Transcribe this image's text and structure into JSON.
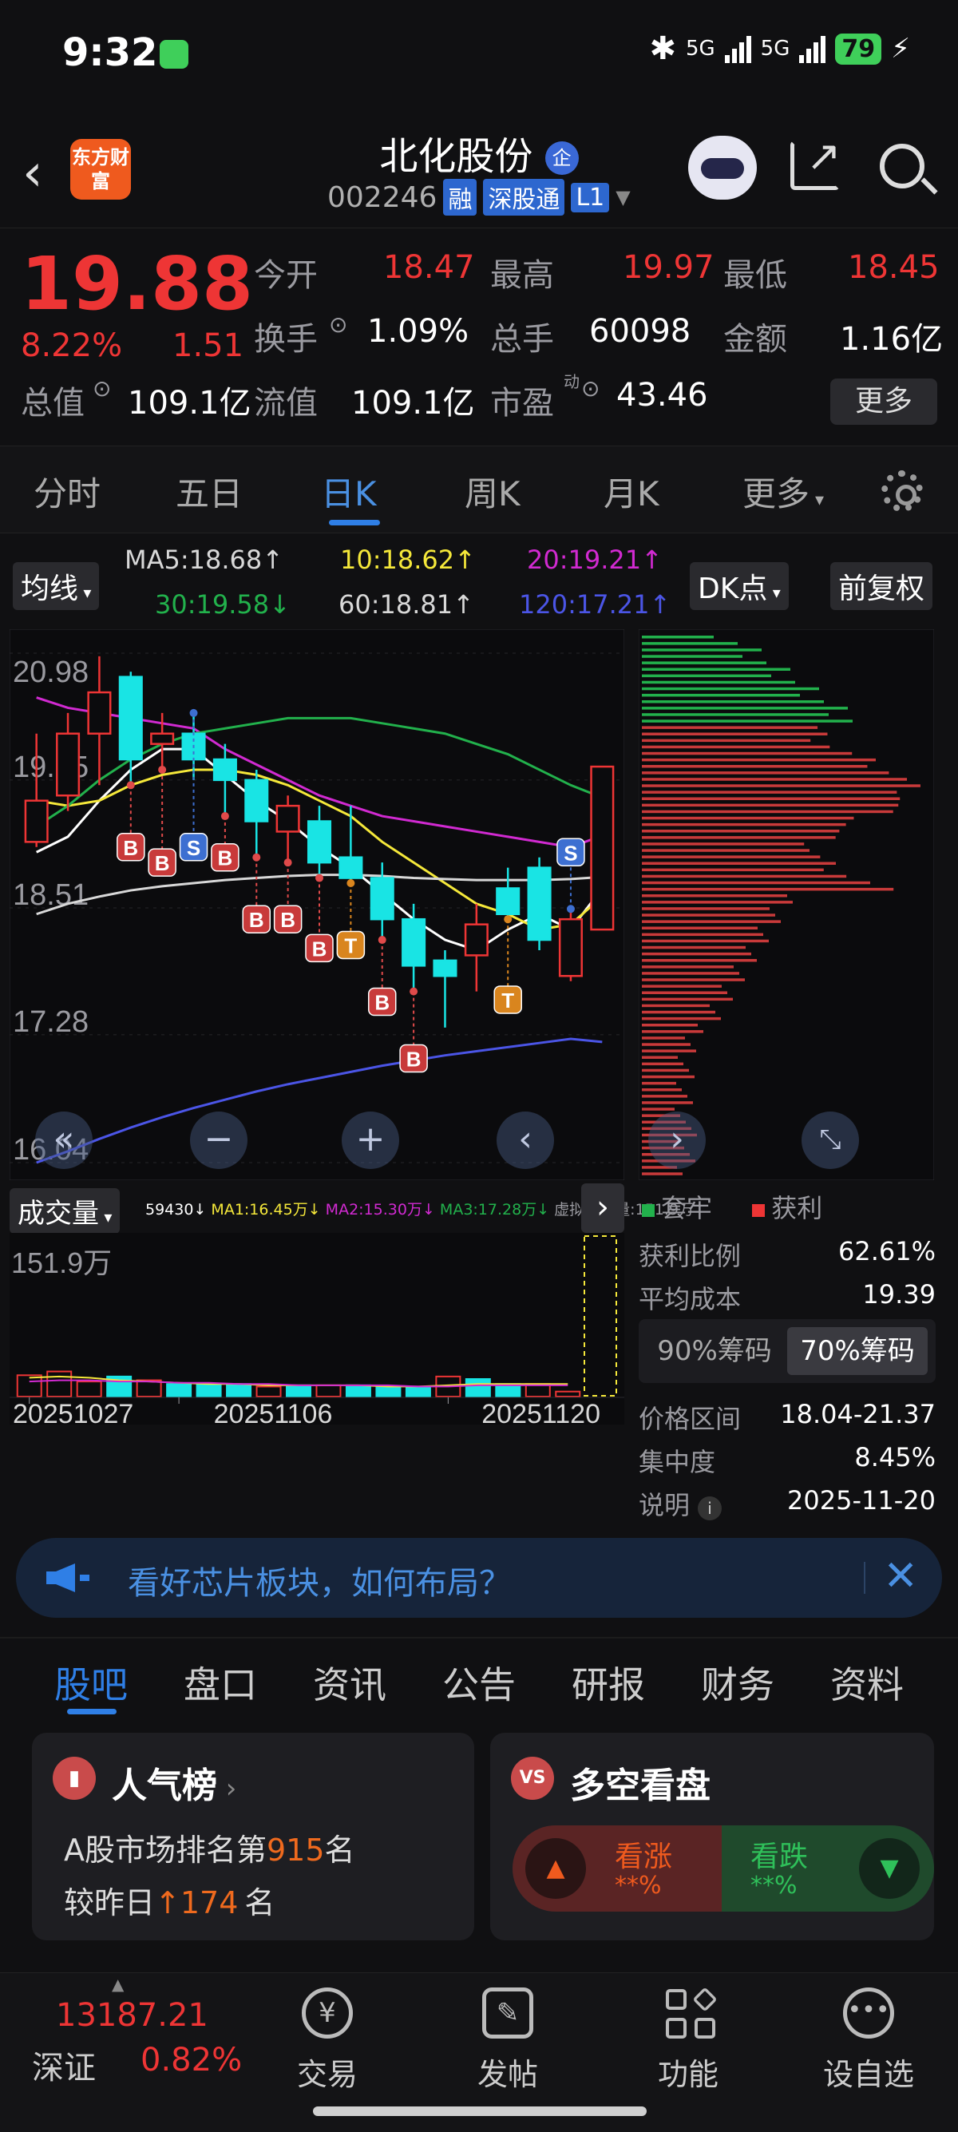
{
  "status_bar": {
    "time": "9:32",
    "net1": "5G",
    "net2": "5G",
    "battery": "79"
  },
  "header": {
    "logo": "东方财富",
    "stock_name": "北化股份",
    "badge": "企",
    "code": "002246",
    "tags": [
      "融",
      "深股通",
      "L1"
    ]
  },
  "quote": {
    "price": "19.88",
    "change_pct": "8.22%",
    "change": "1.51",
    "rows": [
      {
        "label": "今开",
        "value": "18.47"
      },
      {
        "label": "最高",
        "value": "19.97"
      },
      {
        "label": "最低",
        "value": "18.45"
      },
      {
        "label": "换手",
        "value": "1.09%"
      },
      {
        "label": "总手",
        "value": "60098"
      },
      {
        "label": "金额",
        "value": "1.16亿"
      },
      {
        "label": "总值",
        "value": "109.1亿"
      },
      {
        "label": "流值",
        "value": "109.1亿"
      },
      {
        "label": "市盈",
        "value": "43.46"
      }
    ],
    "pe_sup": "动",
    "more": "更多"
  },
  "kline_tabs": [
    "分时",
    "五日",
    "日K",
    "周K",
    "月K",
    "更多"
  ],
  "active_kline_tab": "日K",
  "chart_controls": {
    "ma_dropdown": "均线",
    "dk_dropdown": "DK点",
    "adjust": "前复权"
  },
  "ma_legend": [
    {
      "text": "MA5:18.68",
      "arrow": "↑",
      "color": "#ffffff"
    },
    {
      "text": "10:18.62",
      "arrow": "↑",
      "color": "#f5e83a"
    },
    {
      "text": "20:19.21",
      "arrow": "↑",
      "color": "#d12ad1"
    },
    {
      "text": "30:19.58",
      "arrow": "↓",
      "color": "#22b14c"
    },
    {
      "text": "60:18.81",
      "arrow": "↑",
      "color": "#d8d8d8"
    },
    {
      "text": "120:17.21",
      "arrow": "↑",
      "color": "#4b55e6"
    }
  ],
  "chart_data": {
    "type": "candlestick",
    "y_ticks": [
      "20.98",
      "19.75",
      "18.51",
      "17.28",
      "16.04"
    ],
    "ylim": [
      16.04,
      20.98
    ],
    "x_labels": [
      "20251027",
      "20251106",
      "20251120"
    ],
    "candles": [
      {
        "o": 19.15,
        "h": 20.2,
        "l": 19.1,
        "c": 19.55
      },
      {
        "o": 19.6,
        "h": 20.4,
        "l": 19.45,
        "c": 20.2
      },
      {
        "o": 20.2,
        "h": 20.95,
        "l": 19.7,
        "c": 20.6
      },
      {
        "o": 20.75,
        "h": 20.8,
        "l": 19.7,
        "c": 19.95
      },
      {
        "o": 20.1,
        "h": 20.4,
        "l": 19.85,
        "c": 20.2
      },
      {
        "o": 20.2,
        "h": 20.4,
        "l": 19.75,
        "c": 19.95
      },
      {
        "o": 19.95,
        "h": 20.1,
        "l": 19.4,
        "c": 19.75
      },
      {
        "o": 19.75,
        "h": 19.85,
        "l": 19.0,
        "c": 19.35
      },
      {
        "o": 19.25,
        "h": 19.6,
        "l": 18.95,
        "c": 19.5
      },
      {
        "o": 19.35,
        "h": 19.5,
        "l": 18.8,
        "c": 18.95
      },
      {
        "o": 19.0,
        "h": 19.5,
        "l": 18.75,
        "c": 18.8
      },
      {
        "o": 18.8,
        "h": 18.95,
        "l": 18.2,
        "c": 18.4
      },
      {
        "o": 18.4,
        "h": 18.55,
        "l": 17.7,
        "c": 17.95
      },
      {
        "o": 18.0,
        "h": 18.1,
        "l": 17.35,
        "c": 17.85
      },
      {
        "o": 18.05,
        "h": 18.55,
        "l": 17.7,
        "c": 18.35
      },
      {
        "o": 18.7,
        "h": 18.9,
        "l": 18.4,
        "c": 18.45
      },
      {
        "o": 18.9,
        "h": 19.0,
        "l": 18.1,
        "c": 18.2
      },
      {
        "o": 17.85,
        "h": 18.5,
        "l": 17.8,
        "c": 18.4
      },
      {
        "o": 18.3,
        "h": 19.7,
        "l": 18.3,
        "c": 19.88
      }
    ],
    "markers": [
      {
        "i": 0,
        "t": "B",
        "y": 19.1
      },
      {
        "i": 1,
        "t": "B",
        "y": 18.95
      },
      {
        "i": 2,
        "t": "S",
        "y": 19.1
      },
      {
        "i": 3,
        "t": "B",
        "y": 19.0
      },
      {
        "i": 4,
        "t": "B",
        "y": 18.4
      },
      {
        "i": 5,
        "t": "B",
        "y": 18.4
      },
      {
        "i": 6,
        "t": "B",
        "y": 18.12
      },
      {
        "i": 7,
        "t": "T",
        "y": 18.15
      },
      {
        "i": 8,
        "t": "B",
        "y": 17.6
      },
      {
        "i": 9,
        "t": "B",
        "y": 17.05
      },
      {
        "i": 10,
        "t": "T",
        "y": 17.62
      },
      {
        "i": 11,
        "t": "S",
        "y": 19.05
      }
    ],
    "marker_x_index": [
      3,
      4,
      5,
      6,
      7,
      8,
      9,
      10,
      11,
      12,
      15,
      17
    ],
    "ma_lines": {
      "ma5": [
        19.05,
        19.2,
        19.55,
        19.85,
        20.05,
        20.05,
        19.8,
        19.55,
        19.35,
        19.1,
        18.9,
        18.65,
        18.4,
        18.2,
        18.1,
        18.3,
        18.45,
        18.3,
        18.7
      ],
      "ma10": [
        19.55,
        19.5,
        19.55,
        19.7,
        19.8,
        19.85,
        19.85,
        19.8,
        19.7,
        19.55,
        19.4,
        19.15,
        18.95,
        18.75,
        18.55,
        18.45,
        18.3,
        18.35,
        18.62
      ],
      "ma20": [
        20.55,
        20.45,
        20.4,
        20.35,
        20.3,
        20.25,
        20.05,
        19.9,
        19.75,
        19.6,
        19.5,
        19.4,
        19.35,
        19.3,
        19.25,
        19.2,
        19.15,
        19.1,
        19.21
      ],
      "ma30": [
        19.3,
        19.5,
        19.75,
        19.95,
        20.1,
        20.2,
        20.25,
        20.3,
        20.35,
        20.35,
        20.35,
        20.3,
        20.25,
        20.2,
        20.1,
        20.0,
        19.85,
        19.7,
        19.58
      ],
      "ma60": [
        18.45,
        18.55,
        18.62,
        18.68,
        18.72,
        18.75,
        18.78,
        18.8,
        18.82,
        18.83,
        18.83,
        18.82,
        18.8,
        18.79,
        18.78,
        18.78,
        18.78,
        18.79,
        18.81
      ],
      "ma120": [
        16.04,
        16.15,
        16.27,
        16.38,
        16.48,
        16.57,
        16.65,
        16.73,
        16.8,
        16.86,
        16.92,
        16.98,
        17.03,
        17.08,
        17.12,
        17.16,
        17.2,
        17.24,
        17.21
      ]
    }
  },
  "volume": {
    "title": "成交量",
    "legend": [
      {
        "text": "59430",
        "arrow": "↓",
        "color": "#ffffff"
      },
      {
        "text": "MA1:16.45万",
        "arrow": "↓",
        "color": "#f5e83a"
      },
      {
        "text": "MA2:15.30万",
        "arrow": "↓",
        "color": "#d12ad1"
      },
      {
        "text": "MA3:17.28万",
        "arrow": "↓",
        "color": "#22b14c"
      },
      {
        "text": "虚拟成交量:151.9万",
        "arrow": "",
        "color": "#9a9aa0"
      }
    ],
    "max_label": "151.9万",
    "bars": [
      {
        "v": 0.17,
        "up": true
      },
      {
        "v": 0.2,
        "up": true
      },
      {
        "v": 0.12,
        "up": true
      },
      {
        "v": 0.16,
        "up": false
      },
      {
        "v": 0.13,
        "up": true
      },
      {
        "v": 0.1,
        "up": false
      },
      {
        "v": 0.1,
        "up": false
      },
      {
        "v": 0.1,
        "up": false
      },
      {
        "v": 0.08,
        "up": true
      },
      {
        "v": 0.09,
        "up": false
      },
      {
        "v": 0.09,
        "up": true
      },
      {
        "v": 0.09,
        "up": false
      },
      {
        "v": 0.08,
        "up": false
      },
      {
        "v": 0.07,
        "up": false
      },
      {
        "v": 0.16,
        "up": true
      },
      {
        "v": 0.14,
        "up": false
      },
      {
        "v": 0.1,
        "up": false
      },
      {
        "v": 0.1,
        "up": true
      },
      {
        "v": 0.04,
        "up": true
      }
    ]
  },
  "chip_info": {
    "legend_loss": "套牢",
    "legend_profit": "获利",
    "rows1": [
      {
        "label": "获利比例",
        "value": "62.61%"
      },
      {
        "label": "平均成本",
        "value": "19.39"
      }
    ],
    "btn90": "90%筹码",
    "btn70": "70%筹码",
    "rows2": [
      {
        "label": "价格区间",
        "value": "18.04-21.37"
      },
      {
        "label": "集中度",
        "value": "8.45%"
      },
      {
        "label": "说明",
        "value": "2025-11-20"
      }
    ]
  },
  "banner": {
    "text": "看好芯片板块，如何布局？"
  },
  "section_tabs": [
    "股吧",
    "盘口",
    "资讯",
    "公告",
    "研报",
    "财务",
    "资料"
  ],
  "popularity": {
    "title": "人气榜",
    "line1_pre": "A股市场排名第",
    "line1_num": "915",
    "line1_post": "名",
    "line2_pre": "较昨日",
    "line2_num": "174",
    "line2_post": "名"
  },
  "vs": {
    "title": "多空看盘",
    "up_label": "看涨",
    "up_value": "**%",
    "down_label": "看跌",
    "down_value": "**%"
  },
  "bottom_nav": {
    "index_value": "13187.21",
    "index_name": "深证",
    "index_change": "0.82%",
    "items": [
      "交易",
      "发帖",
      "功能",
      "设自选"
    ]
  }
}
